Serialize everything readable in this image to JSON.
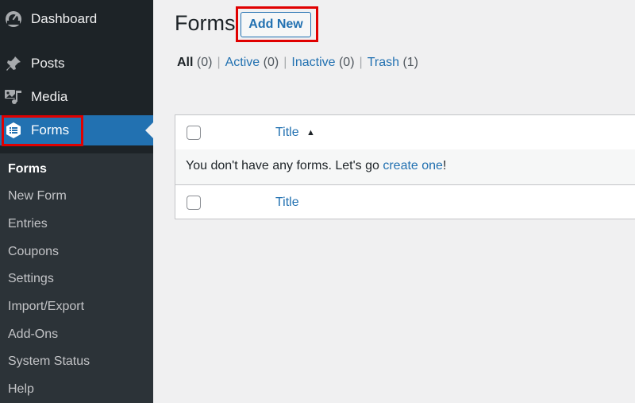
{
  "sidebar": {
    "menu": [
      {
        "label": "Dashboard",
        "icon": "dashboard-icon"
      },
      {
        "label": "Posts",
        "icon": "pin-icon"
      },
      {
        "label": "Media",
        "icon": "media-icon"
      },
      {
        "label": "Forms",
        "icon": "forms-icon"
      }
    ],
    "submenu": [
      "Forms",
      "New Form",
      "Entries",
      "Coupons",
      "Settings",
      "Import/Export",
      "Add-Ons",
      "System Status",
      "Help"
    ]
  },
  "main": {
    "title": "Forms",
    "add_new_label": "Add New",
    "filters": {
      "all": {
        "label": "All",
        "count": "(0)"
      },
      "active": {
        "label": "Active",
        "count": "(0)"
      },
      "inactive": {
        "label": "Inactive",
        "count": "(0)"
      },
      "trash": {
        "label": "Trash",
        "count": "(1)"
      },
      "separator": "|"
    },
    "table": {
      "column_title": "Title",
      "sort_indicator": "▲",
      "empty_text_before": "You don't have any forms. Let's go ",
      "empty_link": "create one",
      "empty_text_after": "!"
    }
  },
  "colors": {
    "sidebar_bg": "#1d2327",
    "submenu_bg": "#2c3338",
    "accent": "#2271b1",
    "highlight": "#e00000"
  }
}
